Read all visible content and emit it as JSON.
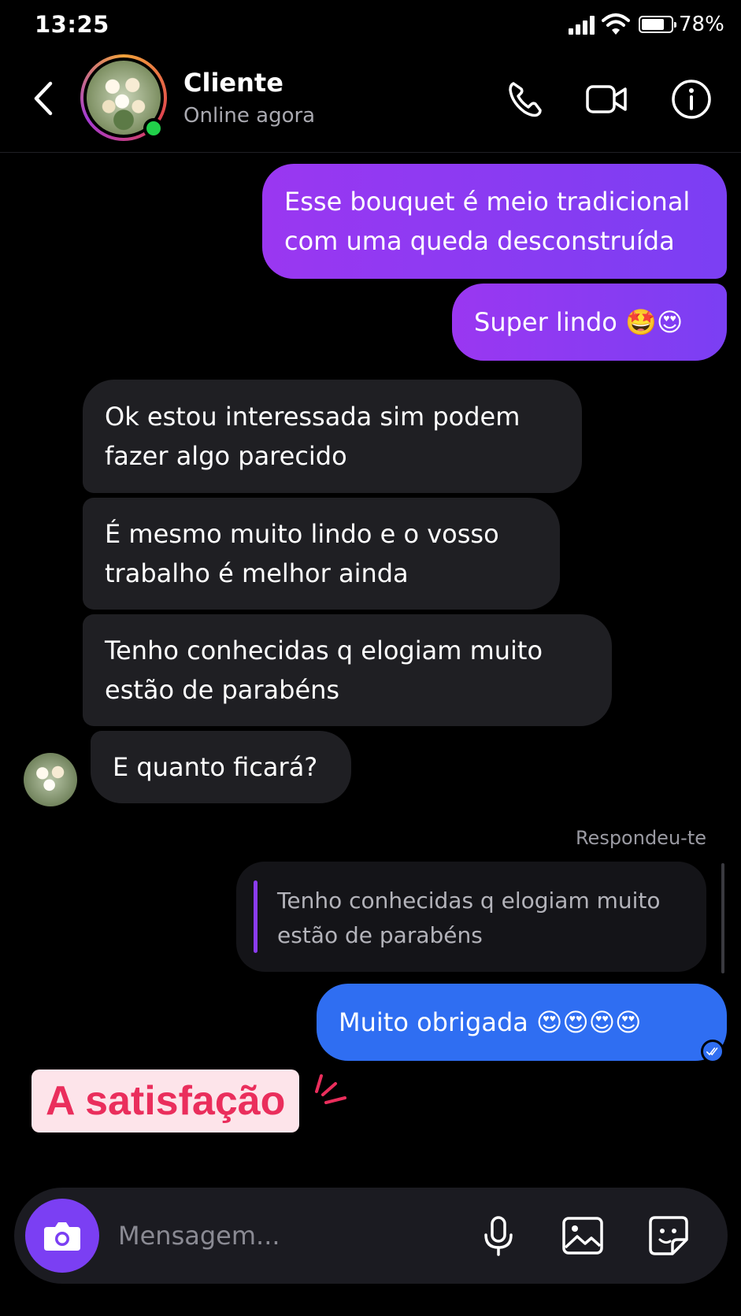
{
  "status_bar": {
    "time": "13:25",
    "battery": "78%",
    "battery_level": 0.78
  },
  "header": {
    "contact_name": "Cliente",
    "contact_status": "Online agora"
  },
  "messages": {
    "out1": "Esse bouquet é meio tradicional com uma queda desconstruída",
    "out2": "Super lindo 🤩😍",
    "in1": "Ok estou interessada sim podem fazer algo parecido",
    "in2": "É mesmo muito lindo e o vosso trabalho é melhor ainda",
    "in3": "Tenho conhecidas q elogiam muito estão de parabéns",
    "in4": "E quanto ficará?",
    "replied_label": "Respondeu-te",
    "quoted": "Tenho conhecidas q elogiam muito estão de parabéns",
    "reply": "Muito obrigada 😍😍😍😍"
  },
  "overlay_caption": "A satisfação",
  "composer": {
    "placeholder": "Mensagem..."
  },
  "colors": {
    "purple": "#8a3cf2",
    "blue": "#2f6ef2",
    "incoming": "#1f1f23",
    "caption": "#ea2e5c"
  }
}
